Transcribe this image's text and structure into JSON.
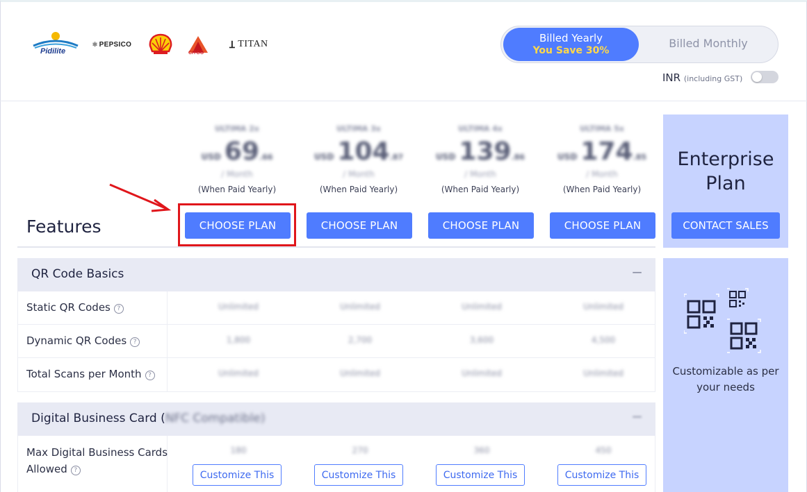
{
  "logos": {
    "pidilite": "Pidilite",
    "pepsico": "PEPSICO",
    "citgo": "CITGO",
    "titan": "TITAN"
  },
  "billing": {
    "yearly_label": "Billed Yearly",
    "yearly_save": "You Save 30%",
    "monthly_label": "Billed Monthly",
    "currency": "INR",
    "currency_note": "(including GST)",
    "inr_toggle_on": false
  },
  "features_title": "Features",
  "plans": [
    {
      "name": "ULTIMA 2x",
      "currency": "USD",
      "price": "69",
      "decimal": ".66",
      "per": "/ Month",
      "paid_note": "(When Paid Yearly)",
      "button": "CHOOSE PLAN"
    },
    {
      "name": "ULTIMA 3x",
      "currency": "USD",
      "price": "104",
      "decimal": ".87",
      "per": "/ Month",
      "paid_note": "(When Paid Yearly)",
      "button": "CHOOSE PLAN"
    },
    {
      "name": "ULTIMA 4x",
      "currency": "USD",
      "price": "139",
      "decimal": ".86",
      "per": "/ Month",
      "paid_note": "(When Paid Yearly)",
      "button": "CHOOSE PLAN"
    },
    {
      "name": "ULTIMA 5x",
      "currency": "USD",
      "price": "174",
      "decimal": ".85",
      "per": "/ Month",
      "paid_note": "(When Paid Yearly)",
      "button": "CHOOSE PLAN"
    }
  ],
  "enterprise": {
    "title_line1": "Enterprise",
    "title_line2": "Plan",
    "button": "CONTACT SALES",
    "desc_line1": "Customizable as per",
    "desc_line2": "your needs"
  },
  "sections": [
    {
      "title": "QR Code Basics",
      "toggle": "−",
      "rows": [
        {
          "label": "Static QR Codes",
          "help": "?",
          "values": [
            "Unlimited",
            "Unlimited",
            "Unlimited",
            "Unlimited"
          ]
        },
        {
          "label": "Dynamic QR Codes",
          "help": "?",
          "values": [
            "1,800",
            "2,700",
            "3,600",
            "4,500"
          ]
        },
        {
          "label": "Total Scans per Month",
          "help": "?",
          "values": [
            "Unlimited",
            "Unlimited",
            "Unlimited",
            "Unlimited"
          ]
        }
      ]
    },
    {
      "title": "Digital Business Card (",
      "title_rest": "NFC Compatible)",
      "toggle": "−",
      "rows": [
        {
          "label_line1": "Max Digital Business Cards",
          "label_line2": "Allowed",
          "help": "?",
          "values": [
            "180",
            "270",
            "360",
            "450"
          ],
          "button": "Customize This"
        }
      ]
    }
  ],
  "colors": {
    "accent": "#4f7cff",
    "enterprise_bg": "#c7d3ff",
    "save_text": "#ffd84a",
    "highlight": "#e0161b"
  }
}
